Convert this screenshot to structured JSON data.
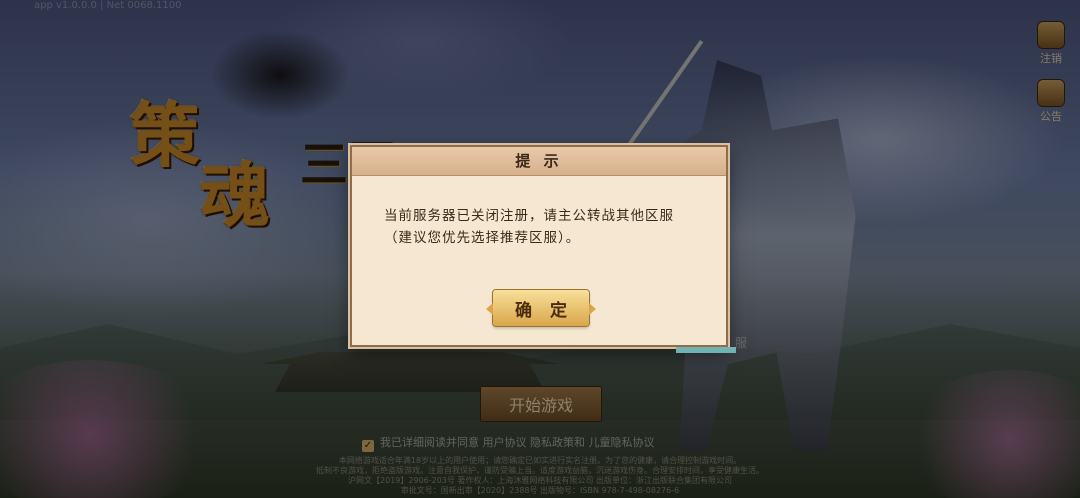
{
  "version_text": "app v1.0.0.0 | Net 0068.1100",
  "side_buttons": [
    {
      "label": "注销",
      "icon": "account-icon"
    },
    {
      "label": "公告",
      "icon": "notice-icon"
    }
  ],
  "logo": {
    "c1": "策",
    "c2": "魂",
    "c3": "三国"
  },
  "behind_text": "服",
  "start_button": "开始游戏",
  "agreement": "我已详细阅读并同意 用户协议 隐私政策和 儿童隐私协议",
  "footer": [
    "本网络游戏适合年满18岁以上的用户使用；请您确定已如实进行实名注册。为了您的健康，请合理控制游戏时间。",
    "抵制不良游戏，拒绝盗版游戏。注意自我保护，谨防受骗上当。适度游戏益脑，沉迷游戏伤身。合理安排时间，享受健康生活。",
    "沪网文【2019】2906-203号  著作权人：上海沐雅网络科技有限公司  出版单位：浙江出版联合集团有限公司",
    "审批文号：国新出审【2020】2388号  出版物号：ISBN 978-7-498-08276-6"
  ],
  "dialog": {
    "title": "提 示",
    "message": "当前服务器已关闭注册，请主公转战其他区服（建议您优先选择推荐区服）。",
    "confirm": "确 定"
  }
}
